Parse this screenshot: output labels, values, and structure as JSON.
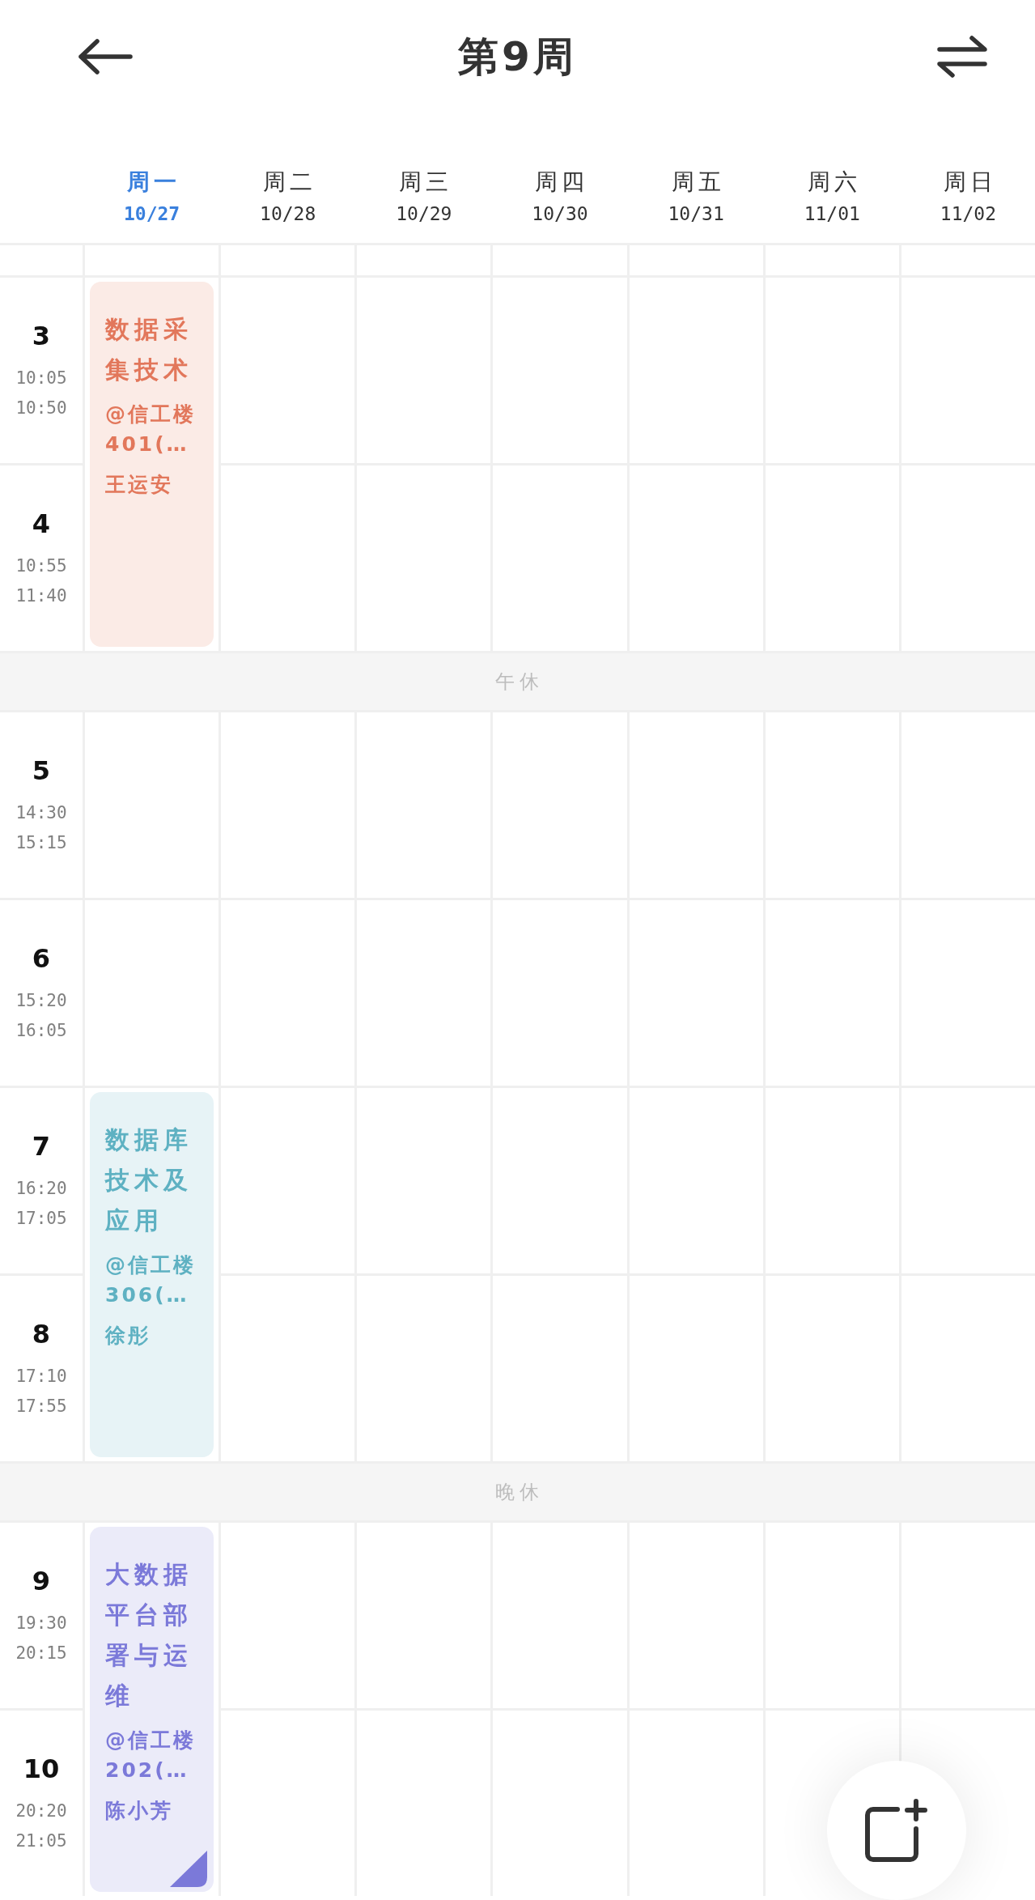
{
  "header": {
    "title": "第9周"
  },
  "days": [
    {
      "weekday": "周一",
      "date": "10/27",
      "today": true
    },
    {
      "weekday": "周二",
      "date": "10/28",
      "today": false
    },
    {
      "weekday": "周三",
      "date": "10/29",
      "today": false
    },
    {
      "weekday": "周四",
      "date": "10/30",
      "today": false
    },
    {
      "weekday": "周五",
      "date": "10/31",
      "today": false
    },
    {
      "weekday": "周六",
      "date": "11/01",
      "today": false
    },
    {
      "weekday": "周日",
      "date": "11/02",
      "today": false
    }
  ],
  "schedule": [
    {
      "kind": "periods",
      "periods": [
        {
          "number": "3",
          "start": "10:05",
          "end": "10:50"
        },
        {
          "number": "4",
          "start": "10:55",
          "end": "11:40"
        }
      ],
      "cells": [
        {
          "kind": "course",
          "title": "数据采集技术",
          "location": "@信工楼401(…",
          "teacher": "王运安",
          "color": "#e2775b",
          "corner_flag": false
        },
        {
          "kind": "empty"
        },
        {
          "kind": "empty"
        },
        {
          "kind": "empty"
        },
        {
          "kind": "empty"
        },
        {
          "kind": "empty"
        },
        {
          "kind": "empty"
        }
      ]
    },
    {
      "kind": "break",
      "label": "午休"
    },
    {
      "kind": "periods",
      "periods": [
        {
          "number": "5",
          "start": "14:30",
          "end": "15:15"
        },
        {
          "number": "6",
          "start": "15:20",
          "end": "16:05"
        }
      ],
      "cells": [
        {
          "kind": "empty"
        },
        {
          "kind": "empty"
        },
        {
          "kind": "empty"
        },
        {
          "kind": "empty"
        },
        {
          "kind": "empty"
        },
        {
          "kind": "empty"
        },
        {
          "kind": "empty"
        }
      ]
    },
    {
      "kind": "periods",
      "periods": [
        {
          "number": "7",
          "start": "16:20",
          "end": "17:05"
        },
        {
          "number": "8",
          "start": "17:10",
          "end": "17:55"
        }
      ],
      "cells": [
        {
          "kind": "course",
          "title": "数据库技术及应用",
          "location": "@信工楼306(…",
          "teacher": "徐彤",
          "color": "#5eb1c2",
          "corner_flag": false
        },
        {
          "kind": "empty"
        },
        {
          "kind": "empty"
        },
        {
          "kind": "empty"
        },
        {
          "kind": "empty"
        },
        {
          "kind": "empty"
        },
        {
          "kind": "empty"
        }
      ]
    },
    {
      "kind": "break",
      "label": "晚休"
    },
    {
      "kind": "periods",
      "periods": [
        {
          "number": "9",
          "start": "19:30",
          "end": "20:15"
        },
        {
          "number": "10",
          "start": "20:20",
          "end": "21:05"
        }
      ],
      "cells": [
        {
          "kind": "course",
          "title": "大数据平台部署与运维",
          "location": "@信工楼202(…",
          "teacher": "陈小芳",
          "color": "#7b79d9",
          "corner_flag": true
        },
        {
          "kind": "empty"
        },
        {
          "kind": "empty"
        },
        {
          "kind": "empty"
        },
        {
          "kind": "empty"
        },
        {
          "kind": "empty"
        },
        {
          "kind": "empty"
        }
      ]
    }
  ]
}
